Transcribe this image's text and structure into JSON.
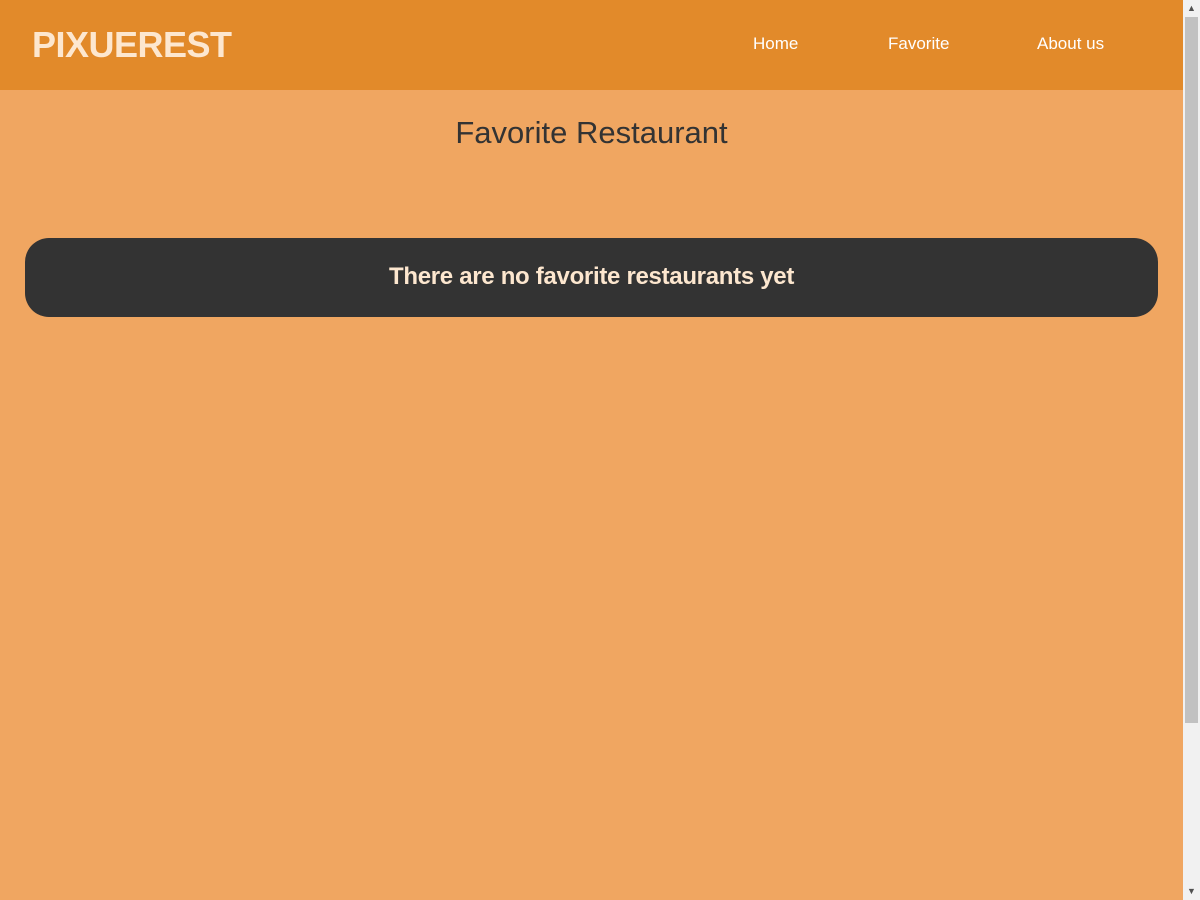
{
  "header": {
    "brand": "PIXUEREST",
    "nav": {
      "home": "Home",
      "favorite": "Favorite",
      "about": "About us"
    }
  },
  "main": {
    "title": "Favorite Restaurant",
    "empty_message": "There are no favorite restaurants yet"
  },
  "scrollbar": {
    "up_icon": "▲",
    "down_icon": "▼"
  },
  "colors": {
    "header_bg": "#e28a2a",
    "page_bg": "#f0a661",
    "card_bg": "#333333",
    "brand_text": "#fde7cf"
  }
}
